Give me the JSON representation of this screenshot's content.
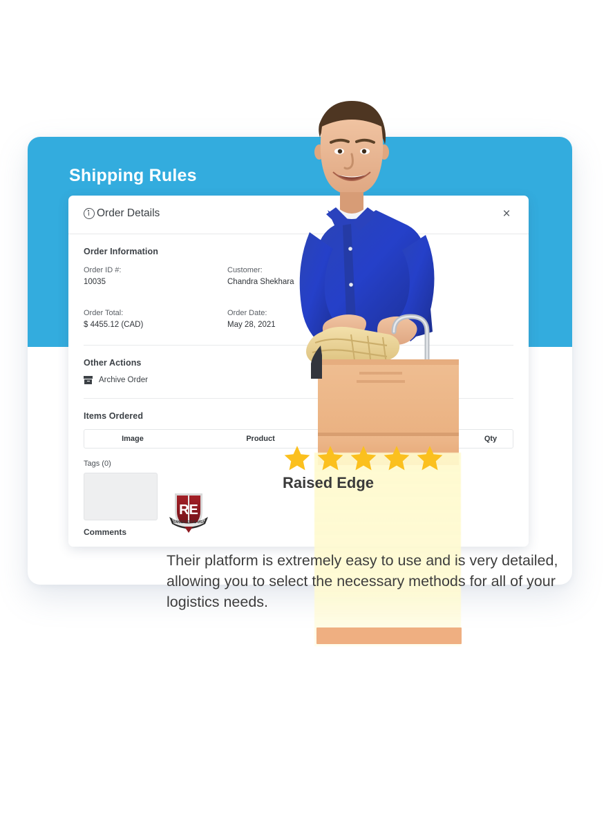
{
  "banner": {
    "title": "Shipping Rules",
    "accent_color": "#33ACDE"
  },
  "modal": {
    "title": "Order Details",
    "info_icon": "info-circle-icon",
    "close_label": "×",
    "order_information": {
      "heading": "Order Information",
      "fields": [
        {
          "label": "Order ID #:",
          "value": "10035"
        },
        {
          "label": "Customer:",
          "value": "Chandra Shekhara"
        },
        {
          "label": "Order Total:",
          "value": "$ 4455.12 (CAD)"
        },
        {
          "label": "Order Date:",
          "value": "May 28, 2021"
        }
      ]
    },
    "other_actions": {
      "heading": "Other Actions",
      "archive_label": "Archive Order"
    },
    "items_ordered": {
      "heading": "Items Ordered",
      "columns": [
        "Image",
        "Product",
        "Qty"
      ]
    },
    "tags": {
      "label": "Tags (0)"
    },
    "comments": {
      "label": "Comments"
    }
  },
  "testimonial": {
    "logo_alt": "raised-edge-logo",
    "rating": 5,
    "rating_max": 5,
    "star_color": "#FBC01E",
    "company": "Raised Edge",
    "quote": "Their platform is extremely easy to use and is very detailed, allowing you to select the necessary methods for all of your logistics needs."
  }
}
